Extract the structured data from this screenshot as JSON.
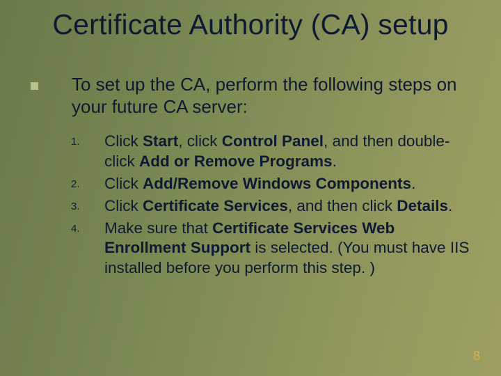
{
  "title": "Certificate Authority (CA) setup",
  "lead": "To set up the CA, perform the following steps on your future CA server:",
  "steps": [
    {
      "num": "1.",
      "html": "Click <b>Start</b>, click <b>Control Panel</b>, and then double-click <b>Add or Remove Programs</b>."
    },
    {
      "num": "2.",
      "html": "Click <b>Add/Remove Windows Components</b>."
    },
    {
      "num": "3.",
      "html": "Click <b>Certificate Services</b>, and then click <b>Details</b>."
    },
    {
      "num": "4.",
      "html": "Make sure that <b>Certificate Services Web Enrollment Support</b> is selected. (You must have IIS installed before you perform this step. )"
    }
  ],
  "page_number": "8"
}
